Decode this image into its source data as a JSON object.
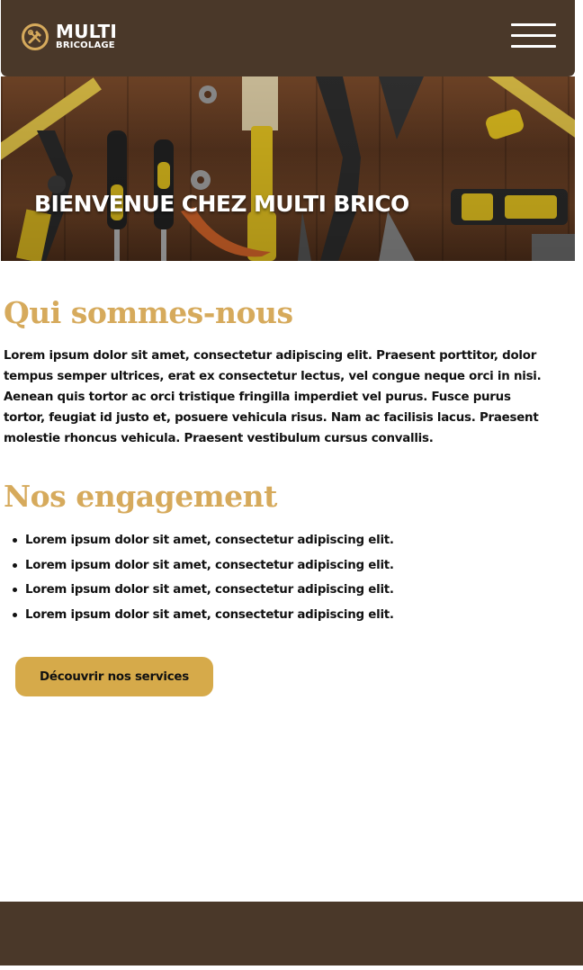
{
  "header": {
    "logo_title": "MULTI",
    "logo_subtitle": "BRICOLAGE",
    "logo_icon": "tools-icon",
    "menu_icon": "hamburger-menu-icon"
  },
  "hero": {
    "title": "Bienvenue chez Multi Brico",
    "image": "tools-on-wooden-table-photo"
  },
  "about": {
    "title": "Qui sommes-nous",
    "text": "Lorem ipsum dolor sit amet, consectetur adipiscing elit. Praesent porttitor, dolor tempus semper ultrices, erat ex consectetur lectus, vel congue neque orci in nisi. Aenean quis tortor ac orci tristique fringilla imperdiet vel purus. Fusce purus tortor, feugiat id justo et, posuere vehicula risus. Nam ac facilisis lacus. Praesent molestie rhoncus vehicula. Praesent vestibulum cursus convallis."
  },
  "commitments": {
    "title": "Nos engagement",
    "items": [
      "Lorem ipsum dolor sit amet, consectetur adipiscing elit.",
      "Lorem ipsum dolor sit amet, consectetur adipiscing elit.",
      "Lorem ipsum dolor sit amet, consectetur adipiscing elit.",
      "Lorem ipsum dolor sit amet, consectetur adipiscing elit."
    ]
  },
  "cta": {
    "label": "Découvrir nos services"
  },
  "colors": {
    "brown": "#4a3829",
    "gold": "#d6aa5c",
    "button": "#d6aa4a"
  }
}
